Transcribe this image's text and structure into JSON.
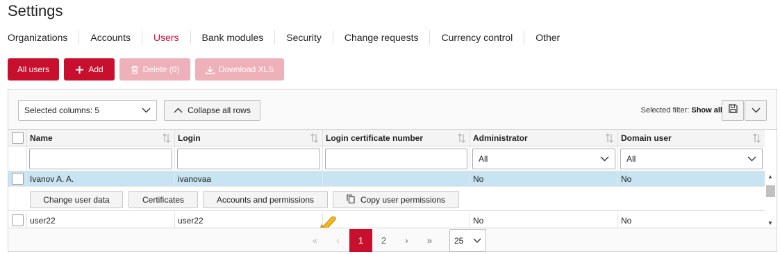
{
  "page": {
    "title": "Settings"
  },
  "tabs": [
    {
      "label": "Organizations"
    },
    {
      "label": "Accounts"
    },
    {
      "label": "Users",
      "active": true
    },
    {
      "label": "Bank modules"
    },
    {
      "label": "Security"
    },
    {
      "label": "Change requests"
    },
    {
      "label": "Currency control"
    },
    {
      "label": "Other"
    }
  ],
  "actions": {
    "all_users": "All users",
    "add": "Add",
    "delete": "Delete (0)",
    "download": "Download XLS"
  },
  "toolbar": {
    "selected_columns": "Selected columns: 5",
    "collapse": "Collapse all rows",
    "filter_label": "Selected filter:",
    "filter_value": "Show all"
  },
  "table": {
    "columns": [
      "Name",
      "Login",
      "Login certificate number",
      "Administrator",
      "Domain user"
    ],
    "filters": {
      "administrator": "All",
      "domain_user": "All"
    },
    "rows": [
      {
        "name": "Ivanov A. A.",
        "login": "ivanovaa",
        "certificate": "",
        "administrator": "No",
        "domain_user": "No",
        "selected": true
      },
      {
        "name": "user22",
        "login": "user22",
        "certificate": "",
        "administrator": "No",
        "domain_user": "No"
      }
    ],
    "row_actions": {
      "change_user_data": "Change user data",
      "certificates": "Certificates",
      "accounts_permissions": "Accounts and permissions",
      "copy_permissions": "Copy user permissions"
    }
  },
  "pagination": {
    "first": "«",
    "prev": "‹",
    "pages": [
      "1",
      "2"
    ],
    "current": "1",
    "next": "›",
    "last": "»",
    "page_size": "25"
  },
  "colors": {
    "accent": "#c8102e",
    "selected_row": "#c8e3f1",
    "disabled_button": "#eeb1b9"
  },
  "icons": [
    "plus-icon",
    "trash-icon",
    "download-icon",
    "chevron-down-icon",
    "chevron-up-icon",
    "save-icon",
    "sort-icon",
    "copy-icon",
    "arrow-pointer-icon"
  ]
}
